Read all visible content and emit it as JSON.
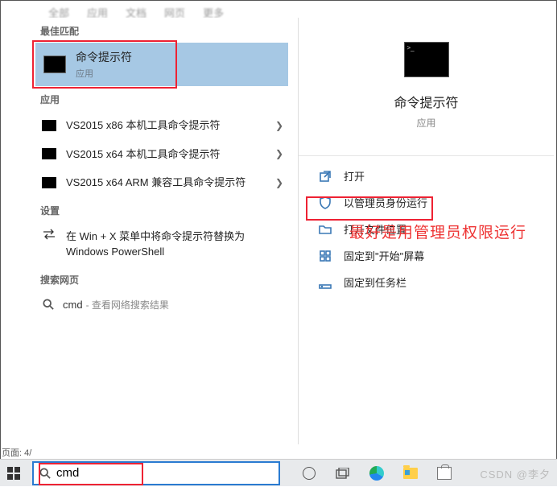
{
  "tabs": {
    "t0": "全部",
    "t1": "应用",
    "t2": "文档",
    "t3": "网页",
    "t4": "更多"
  },
  "sections": {
    "best_match": "最佳匹配",
    "apps": "应用",
    "settings": "设置",
    "search_web": "搜索网页"
  },
  "best": {
    "title": "命令提示符",
    "subtitle": "应用"
  },
  "apps_list": {
    "a0": "VS2015 x86 本机工具命令提示符",
    "a1": "VS2015 x64 本机工具命令提示符",
    "a2": "VS2015 x64 ARM 兼容工具命令提示符"
  },
  "settings_list": {
    "s0": "在 Win + X 菜单中将命令提示符替换为 Windows PowerShell"
  },
  "web": {
    "query": "cmd",
    "hint": "- 查看网络搜索结果"
  },
  "hero": {
    "title": "命令提示符",
    "subtitle": "应用"
  },
  "actions": {
    "open": "打开",
    "run_admin": "以管理员身份运行",
    "open_location": "打开文件位置",
    "pin_start": "固定到\"开始\"屏幕",
    "pin_taskbar": "固定到任务栏"
  },
  "overlay": "最好是用管理员权限运行",
  "footer": "页面: 4/",
  "search_value": "cmd",
  "watermark": "CSDN @李夕"
}
